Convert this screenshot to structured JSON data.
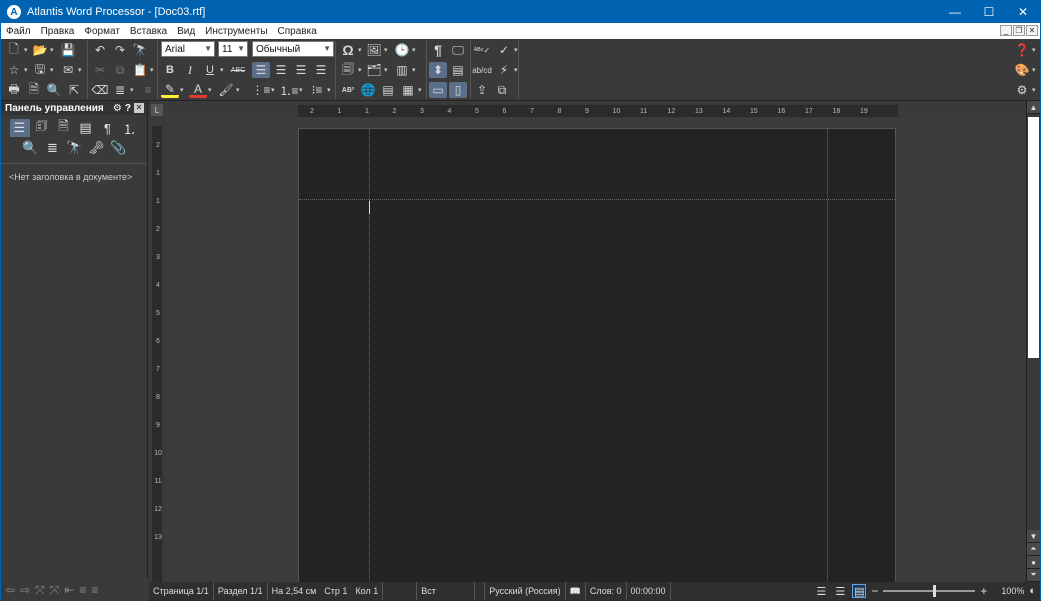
{
  "window": {
    "title": "Atlantis Word Processor - [Doc03.rtf]",
    "app_icon_glyph": "A",
    "minimize_glyph": "—",
    "maximize_glyph": "☐",
    "close_glyph": "✕"
  },
  "menu": {
    "items": [
      "Файл",
      "Правка",
      "Формат",
      "Вставка",
      "Вид",
      "Инструменты",
      "Справка"
    ],
    "mdi_minimize": "_",
    "mdi_restore": "❐",
    "mdi_close": "✕"
  },
  "toolbar": {
    "font_name": "Arial",
    "font_size": "11",
    "style_name": "Обычный",
    "bold_label": "B",
    "italic_label": "I",
    "underline_label": "U",
    "strike_label": "ABC",
    "superscript_label": "AB²"
  },
  "panel": {
    "title": "Панель управления",
    "empty_text": "<Нет заголовка в документе>"
  },
  "ruler": {
    "h_ticks": [
      "2",
      "1",
      "1",
      "2",
      "3",
      "4",
      "5",
      "6",
      "7",
      "8",
      "9",
      "10",
      "11",
      "12",
      "13",
      "14",
      "15",
      "16",
      "17",
      "18",
      "19"
    ],
    "v_ticks": [
      "2",
      "1",
      "1",
      "2",
      "3",
      "4",
      "5",
      "6",
      "7",
      "8",
      "9",
      "10",
      "11",
      "12",
      "13"
    ],
    "corner_glyph": "L"
  },
  "statusbar": {
    "page": "Страница 1/1",
    "section": "Раздел 1/1",
    "position": "На 2,54 см",
    "line": "Стр 1",
    "column": "Кол 1",
    "insert_mode": "Вст",
    "language": "Русский (Россия)",
    "words": "Слов: 0",
    "time": "00:00:00",
    "zoom": "100%"
  },
  "colors": {
    "titlebar": "#0063b1",
    "page_bg": "#232323",
    "workspace": "#3a3a3a"
  }
}
